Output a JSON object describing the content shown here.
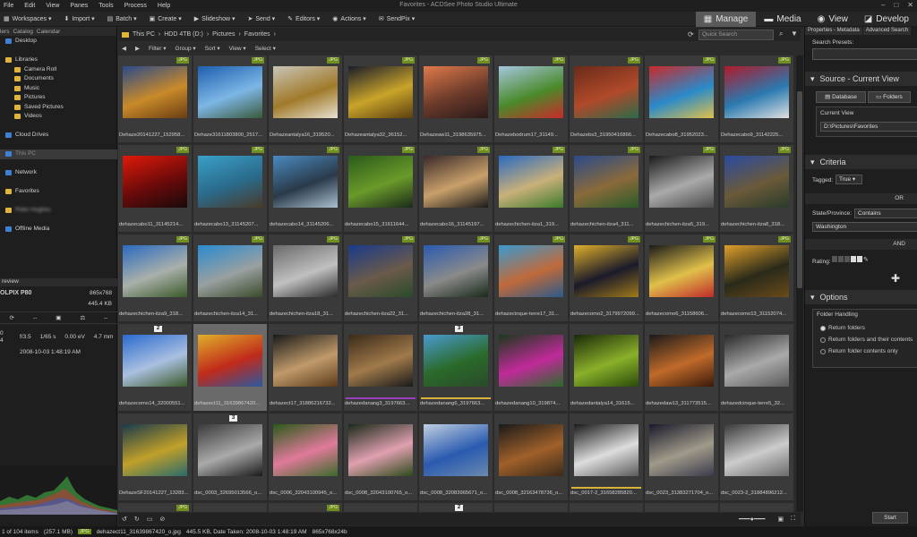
{
  "window": {
    "title": "Favorites - ACDSee Photo Studio Ultimate",
    "menu": [
      "File",
      "Edit",
      "View",
      "Panes",
      "Tools",
      "Process",
      "Help"
    ]
  },
  "toolbar": {
    "items": [
      "Workspaces ▾",
      "Import ▾",
      "Batch ▾",
      "Create ▾",
      "Slideshow ▾",
      "Send ▾",
      "Editors ▾",
      "Actions ▾",
      "SendPix ▾"
    ],
    "modes": [
      {
        "label": "Manage",
        "active": true,
        "icon": "grid-icon"
      },
      {
        "label": "Media",
        "active": false,
        "icon": "media-icon"
      },
      {
        "label": "View",
        "active": false,
        "icon": "eye-icon"
      },
      {
        "label": "Develop",
        "active": false,
        "icon": "develop-icon"
      }
    ]
  },
  "left_panel": {
    "tabs": [
      "lers",
      "Catalog",
      "Calendar"
    ],
    "tree": [
      {
        "label": "Desktop",
        "icon": "blue",
        "indent": 1
      },
      {
        "label": "",
        "icon": "none",
        "indent": 1
      },
      {
        "label": "Libraries",
        "icon": "folder",
        "indent": 1
      },
      {
        "label": "Camera Roll",
        "icon": "folder",
        "indent": 2
      },
      {
        "label": "Documents",
        "icon": "folder",
        "indent": 2
      },
      {
        "label": "Music",
        "icon": "folder",
        "indent": 2
      },
      {
        "label": "Pictures",
        "icon": "folder",
        "indent": 2
      },
      {
        "label": "Saved Pictures",
        "icon": "folder",
        "indent": 2
      },
      {
        "label": "Videos",
        "icon": "folder",
        "indent": 2
      },
      {
        "label": "",
        "icon": "none",
        "indent": 1
      },
      {
        "label": "Cloud Drives",
        "icon": "blue",
        "indent": 1
      },
      {
        "label": "",
        "icon": "none",
        "indent": 1
      },
      {
        "label": "This PC",
        "icon": "blue",
        "indent": 1,
        "sel": true
      },
      {
        "label": "",
        "icon": "none",
        "indent": 1
      },
      {
        "label": "Network",
        "icon": "blue",
        "indent": 1
      },
      {
        "label": "",
        "icon": "none",
        "indent": 1
      },
      {
        "label": "Favorites",
        "icon": "folder",
        "indent": 1
      },
      {
        "label": "",
        "icon": "none",
        "indent": 1
      },
      {
        "label": "Peter Hughes",
        "icon": "folder",
        "indent": 1,
        "blur": true
      },
      {
        "label": "",
        "icon": "none",
        "indent": 1
      },
      {
        "label": "Offline Media",
        "icon": "blue",
        "indent": 1
      }
    ],
    "preview": {
      "header": "review",
      "camera": "OLPIX P80",
      "dimensions": "865x768",
      "size": "445.4 KB",
      "aperture": "f/3.5",
      "shutter": "1/65 s",
      "ev": "0.00 eV",
      "focal": "4.7 mm",
      "date": "2008-10-03 1:48:19 AM",
      "iso": "0",
      "iso2": "4"
    }
  },
  "path": {
    "crumbs": [
      "This PC",
      "HDD 4TB (D:)",
      "Pictures",
      "Favorites"
    ],
    "search_placeholder": "Quick Search"
  },
  "filterbar": [
    "Filter ▾",
    "Group ▾",
    "Sort ▾",
    "View ▾",
    "Select ▾"
  ],
  "colors": {
    "jpg_badge": "#6f8f1f",
    "accent_yellow": "#d9b23a",
    "accent_purple": "#9c3fbf"
  },
  "thumbnails": [
    {
      "cap": "Dehaze20141227_152958...",
      "badge": "JPG",
      "c": [
        "#2b4a8a",
        "#c98a2a",
        "#6a3d12"
      ]
    },
    {
      "cap": "Dehaze31611803800_2517...",
      "badge": "JPG",
      "c": [
        "#1c5fae",
        "#7db6e6",
        "#3a5a3a"
      ]
    },
    {
      "cap": "Dehazeantalya16_319520...",
      "badge": "JPG",
      "c": [
        "#c9c4b8",
        "#a07a2a",
        "#e8e1d1"
      ]
    },
    {
      "cap": "Dehazeantalya32_36152...",
      "badge": "JPG",
      "c": [
        "#1a1c2a",
        "#c9a42a",
        "#5a3f10"
      ]
    },
    {
      "cap": "Dehazeaw11_3198635975...",
      "badge": "JPG",
      "c": [
        "#e07a4a",
        "#6b3a2a",
        "#2a1a1a"
      ]
    },
    {
      "cap": "Dehazebodrum17_31149...",
      "badge": "JPG",
      "c": [
        "#a5c6df",
        "#4a8a2a",
        "#c92a2a"
      ]
    },
    {
      "cap": "Dehazebs3_31950416866...",
      "badge": "JPG",
      "c": [
        "#6a2a1a",
        "#b04a2a",
        "#2a6a4a"
      ]
    },
    {
      "cap": "Dehazecabo8_31952023...",
      "badge": "JPG",
      "c": [
        "#c92a2a",
        "#2a8ac9",
        "#e0c04a"
      ]
    },
    {
      "cap": "Dehazecabo9_31142225...",
      "badge": "JPG",
      "c": [
        "#b01a2a",
        "#2a7ab0",
        "#e0e0e0"
      ]
    },
    {
      "cap": "dehazecabo11_31145214...",
      "badge": "JPG",
      "c": [
        "#e01a0a",
        "#6a0a0a",
        "#1a0a0a"
      ]
    },
    {
      "cap": "dehazecabo13_31145207...",
      "badge": "JPG",
      "c": [
        "#3aa0c9",
        "#2a6a8a",
        "#4a3a2a"
      ]
    },
    {
      "cap": "dehazecabo14_31145206...",
      "badge": "JPG",
      "c": [
        "#4a8ac0",
        "#2a3a4a",
        "#aac0d0"
      ]
    },
    {
      "cap": "dehazecabo15_31611644...",
      "badge": "JPG",
      "c": [
        "#2a5a1a",
        "#6a9a2a",
        "#1a2a1a"
      ]
    },
    {
      "cap": "dehazecabo16_31145197...",
      "badge": "JPG",
      "c": [
        "#3a2a2a",
        "#c9a06a",
        "#1a1a1a"
      ]
    },
    {
      "cap": "dehazechichen-itza1_319...",
      "badge": "JPG",
      "c": [
        "#2a6ac0",
        "#c9b07a",
        "#3a7a2a"
      ]
    },
    {
      "cap": "dehazechichen-itza4_311...",
      "badge": "JPG",
      "c": [
        "#2a4a8a",
        "#8a6a3a",
        "#2a5a2a"
      ]
    },
    {
      "cap": "dehazechichen-itza5_319...",
      "badge": "JPG",
      "c": [
        "#1a1a1a",
        "#aaaaaa",
        "#4a4a4a"
      ]
    },
    {
      "cap": "dehazechichen-itza8_318...",
      "badge": "JPG",
      "c": [
        "#2a4aa0",
        "#6a5a3a",
        "#2a3a2a"
      ]
    },
    {
      "cap": "dehazechichen-itza9_318...",
      "badge": "JPG",
      "c": [
        "#2a6ac0",
        "#aab0aa",
        "#3a5a2a"
      ]
    },
    {
      "cap": "dehazechichen-itza14_31...",
      "badge": "JPG",
      "c": [
        "#2a8ad0",
        "#9aa0a0",
        "#3a4a2a"
      ]
    },
    {
      "cap": "dehazechichen-itza18_31...",
      "badge": "JPG",
      "c": [
        "#6a6a6a",
        "#c0c0c0",
        "#2a2a2a"
      ]
    },
    {
      "cap": "dehazechichen-itza22_31...",
      "badge": "JPG",
      "c": [
        "#1a3a8a",
        "#6a5a4a",
        "#2a4a2a"
      ]
    },
    {
      "cap": "dehazechichen-itza28_31...",
      "badge": "JPG",
      "c": [
        "#2a5ab0",
        "#8a8a8a",
        "#1a2a1a"
      ]
    },
    {
      "cap": "dehazecinque-terre17_31...",
      "badge": "JPG",
      "c": [
        "#3a9ad0",
        "#c06a3a",
        "#2a5a8a"
      ]
    },
    {
      "cap": "dehazecomo2_3179972099...",
      "badge": "JPG",
      "c": [
        "#e0b02a",
        "#1a1a2a",
        "#a07a1a"
      ]
    },
    {
      "cap": "dehazecomo6_31158606...",
      "badge": "JPG",
      "c": [
        "#1a1a1a",
        "#e0c04a",
        "#c02a2a"
      ]
    },
    {
      "cap": "dehazecomo13_31152074...",
      "badge": "JPG",
      "c": [
        "#e0a02a",
        "#2a2a1a",
        "#6a4a1a"
      ]
    },
    {
      "cap": "dehazecomo14_32000551...",
      "badge": "2",
      "c": [
        "#2a6ad0",
        "#aac0e0",
        "#3a5a2a"
      ]
    },
    {
      "cap": "dehazect11_31639867420...",
      "badge": "",
      "sel": true,
      "c": [
        "#e0b02a",
        "#c02a1a",
        "#2a5aa0"
      ]
    },
    {
      "cap": "dehazect17_31886216732...",
      "badge": "",
      "c": [
        "#1a1a1a",
        "#c09a6a",
        "#5a3a1a"
      ]
    },
    {
      "cap": "dehazedanang3_3197663...",
      "badge": "",
      "stripe": "#9c3fbf",
      "c": [
        "#3a2a1a",
        "#a07a4a",
        "#1a1a1a"
      ]
    },
    {
      "cap": "dehazedanang6_3197663...",
      "badge": "3",
      "stripe": "#d9b23a",
      "c": [
        "#4a9ad0",
        "#2a6a2a",
        "#2a4a2a"
      ]
    },
    {
      "cap": "dehazedanang10_319874...",
      "badge": "",
      "c": [
        "#1a3a1a",
        "#c02a9a",
        "#2a6a2a"
      ]
    },
    {
      "cap": "dehazedantalya14_31615...",
      "badge": "",
      "c": [
        "#1a2a0a",
        "#8ab02a",
        "#2a4a0a"
      ]
    },
    {
      "cap": "dehazedaw13_311773515...",
      "badge": "",
      "c": [
        "#1a1a1a",
        "#c06a2a",
        "#3a1a0a"
      ]
    },
    {
      "cap": "dehazedcinque-terre5_32...",
      "badge": "",
      "c": [
        "#2a2a2a",
        "#aaaaaa",
        "#5a5a5a"
      ]
    },
    {
      "cap": "DehazeSF20141227_13283...",
      "badge": "",
      "c": [
        "#1a3a4a",
        "#c0a02a",
        "#2a6a6a"
      ]
    },
    {
      "cap": "dsc_0003_32695013566_o...",
      "badge": "3",
      "c": [
        "#3a3a3a",
        "#aaaaaa",
        "#1a1a1a"
      ]
    },
    {
      "cap": "dsc_0006_32043100945_o...",
      "badge": "",
      "c": [
        "#2a5a1a",
        "#e07a9a",
        "#3a6a2a"
      ]
    },
    {
      "cap": "dsc_0008_32043100765_o...",
      "badge": "",
      "c": [
        "#1a2a1a",
        "#e0a0b0",
        "#2a4a1a"
      ]
    },
    {
      "cap": "dsc_0008_32083965671_o...",
      "badge": "",
      "c": [
        "#c0d0e0",
        "#2a5ab0",
        "#6a8ab0"
      ]
    },
    {
      "cap": "dsc_0008_32163478736_o...",
      "badge": "",
      "c": [
        "#1a1a1a",
        "#a0602a",
        "#3a2a1a"
      ]
    },
    {
      "cap": "dsc_0017-2_31658285820...",
      "badge": "",
      "stripe": "#d9b23a",
      "c": [
        "#1a1a1a",
        "#dddddd",
        "#5a5a5a"
      ]
    },
    {
      "cap": "dsc_0023_31383271704_o...",
      "badge": "",
      "c": [
        "#1a1a2a",
        "#a09a8a",
        "#3a3a4a"
      ]
    },
    {
      "cap": "dsc_0023-2_31884896212...",
      "badge": "",
      "c": [
        "#3a3a3a",
        "#cccccc",
        "#6a6a6a"
      ]
    }
  ],
  "row6_badges": [
    "JPG",
    "",
    "JPG",
    "",
    "2",
    "",
    "",
    "",
    ""
  ],
  "status": {
    "count": "1 of 104 items",
    "total_size": "(257.1 MB)",
    "filetype": "JPG",
    "filename": "dehazect11_31639867420_o.jpg",
    "fileinfo": "445.5 KB, Date Taken: 2008-10-03 1:48:19 AM",
    "dims": "865x768x24b"
  },
  "right_panel": {
    "tabs": [
      "Properties - Metadata",
      "Advanced Search"
    ],
    "search_presets_label": "Search Presets:",
    "source_title": "Source - Current View",
    "source_buttons": [
      "Database",
      "Folders"
    ],
    "current_view_label": "Current View",
    "current_view_value": "D:\\Pictures\\Favorites",
    "criteria_title": "Criteria",
    "tagged_label": "Tagged:",
    "tagged_value": "True",
    "or_label": "OR",
    "state_label": "State/Province:",
    "state_op": "Contains",
    "state_value": "Washington",
    "and_label": "AND",
    "rating_label": "Rating:",
    "options_title": "Options",
    "folder_handling_label": "Folder Handling",
    "radio_options": [
      {
        "label": "Return folders",
        "on": true
      },
      {
        "label": "Return folders and their contents",
        "on": false
      },
      {
        "label": "Return folder contents only",
        "on": false
      }
    ],
    "start_button": "Start"
  }
}
